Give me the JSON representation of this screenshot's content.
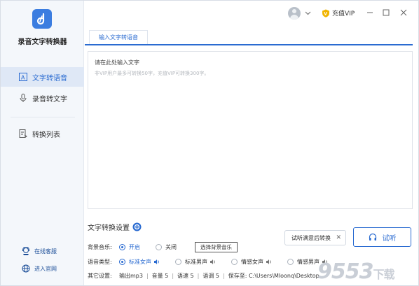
{
  "app": {
    "name": "录音文字转换器"
  },
  "nav": [
    {
      "label": "文字转语音",
      "icon": "text-to-speech-icon",
      "active": true
    },
    {
      "label": "录音转文字",
      "icon": "microphone-icon",
      "active": false
    },
    {
      "label": "转换列表",
      "icon": "conversion-list-icon",
      "active": false
    }
  ],
  "side_links": [
    {
      "label": "在线客服",
      "icon": "customer-service-icon"
    },
    {
      "label": "进入官网",
      "icon": "globe-icon"
    }
  ],
  "topbar": {
    "vip_label": "充值VIP"
  },
  "tab": {
    "label": "输入文字转语音"
  },
  "editor": {
    "placeholder": "请在此处输入文字",
    "hint": "非VIP用户最多可转换50字，充值VIP可转换300字。"
  },
  "settings": {
    "title": "文字转换设置",
    "bg_music": {
      "label": "背景音乐:",
      "options": [
        "开启",
        "关闭"
      ],
      "selected": "开启",
      "button": "选择背景音乐"
    },
    "voice_type": {
      "label": "语音类型:",
      "options": [
        "标准女声",
        "标准男声",
        "情感女声",
        "情感男声"
      ],
      "selected": "标准女声"
    },
    "other": {
      "label": "其它设置:",
      "format": "输出mp3",
      "volume": "音量 5",
      "speed": "语速 5",
      "pitch": "语调 5",
      "save_to": "保存至: C:\\Users\\Mloonq\\Desktop"
    }
  },
  "tooltip": {
    "text": "试听满意后转换"
  },
  "listen_button": {
    "label": "试听"
  },
  "watermark": {
    "text": "9553",
    "suffix": "下载"
  },
  "colors": {
    "accent": "#2a6bd1",
    "vip_gold": "#f0b400",
    "sidebar_bg": "#f4f7fb"
  }
}
